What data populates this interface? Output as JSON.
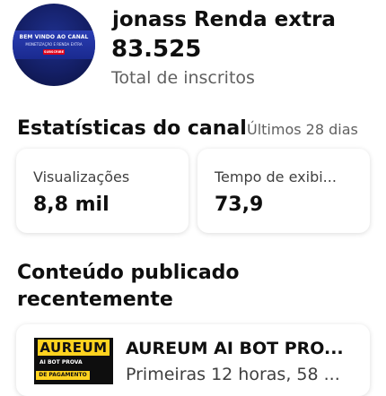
{
  "channel": {
    "avatar": {
      "line1": "BEM VINDO AO CANAL",
      "line2": "MONETIZAÇÃO E RENDA EXTRA",
      "button": "SUBSCRIBE"
    },
    "name": "jonass Renda extra",
    "subscribers": "83.525",
    "subscribers_label": "Total de inscritos"
  },
  "stats": {
    "title": "Estatísticas do canal",
    "period": "Últimos 28 dias",
    "cards": [
      {
        "label": "Visualizações",
        "value": "8,8 mil"
      },
      {
        "label": "Tempo de exibi...",
        "value": "73,9"
      }
    ]
  },
  "recent": {
    "title": "Conteúdo publicado recentemente",
    "video": {
      "thumb_brand": "AUREUM",
      "thumb_sub": "AI BOT PROVA",
      "thumb_pay": "DE PAGAMENTO",
      "title": "AUREUM AI BOT PRO...",
      "meta": "Primeiras 12 horas, 58 ..."
    }
  }
}
